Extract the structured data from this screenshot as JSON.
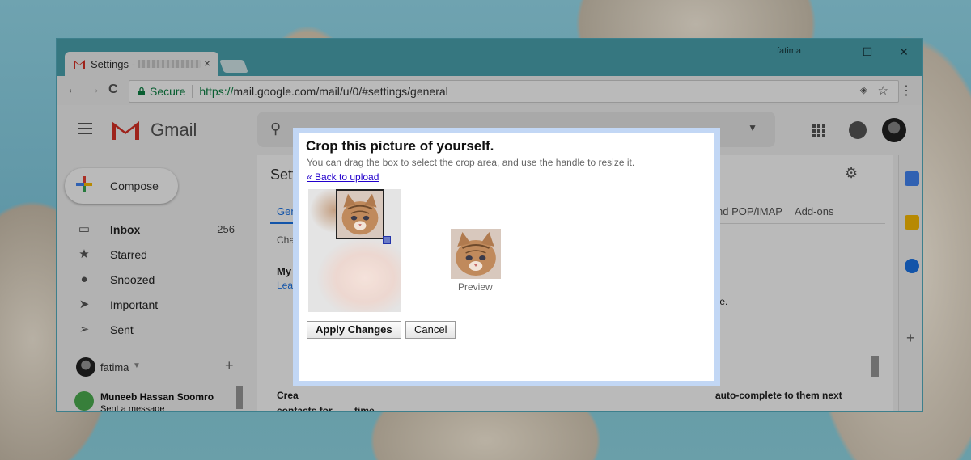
{
  "window": {
    "tab_title": "Settings -",
    "tab_close": "×",
    "user": "fatima",
    "minimize": "–",
    "maximize": "☐",
    "close": "✕"
  },
  "toolbar": {
    "back": "←",
    "forward": "→",
    "reload": "C",
    "secure_label": "Secure",
    "url_scheme": "https://",
    "url_rest": "mail.google.com/mail/u/0/#settings/general",
    "bookmark": "☆",
    "menu": "⋮"
  },
  "gmail": {
    "brand": "Gmail",
    "compose_label": "Compose",
    "nav": [
      {
        "label": "Inbox",
        "count": "256",
        "icon": "inbox-icon"
      },
      {
        "label": "Starred",
        "count": "",
        "icon": "star-icon"
      },
      {
        "label": "Snoozed",
        "count": "",
        "icon": "clock-icon"
      },
      {
        "label": "Important",
        "count": "",
        "icon": "important-icon"
      },
      {
        "label": "Sent",
        "count": "",
        "icon": "send-icon"
      }
    ],
    "hangouts_user": "fatima",
    "hangouts_add": "+",
    "contact_name": "Muneeb Hassan Soomro",
    "contact_msg": "Sent a message"
  },
  "settings": {
    "title": "Sett",
    "tab_general": "Gen",
    "tab_pop": "nd POP/IMAP",
    "tab_addons": "Add-ons",
    "row_cha": "Cha",
    "row_my": "My",
    "row_lea": "Lea",
    "row_one": "one.",
    "row_crea": "Crea",
    "row_contacts": "contacts for",
    "row_auto": "auto-complete to them next",
    "row_time": "time"
  },
  "dialog": {
    "title": "Crop this picture of yourself.",
    "subtitle": "You can drag the box to select the crop area, and use the handle to resize it.",
    "back_link": "« Back to upload",
    "preview_label": "Preview",
    "apply_label": "Apply Changes",
    "cancel_label": "Cancel"
  },
  "colors": {
    "accent_blue": "#1a73e8",
    "dialog_border": "#c2d7f5",
    "secure_green": "#0b8043",
    "gmail_red": "#d93025"
  }
}
